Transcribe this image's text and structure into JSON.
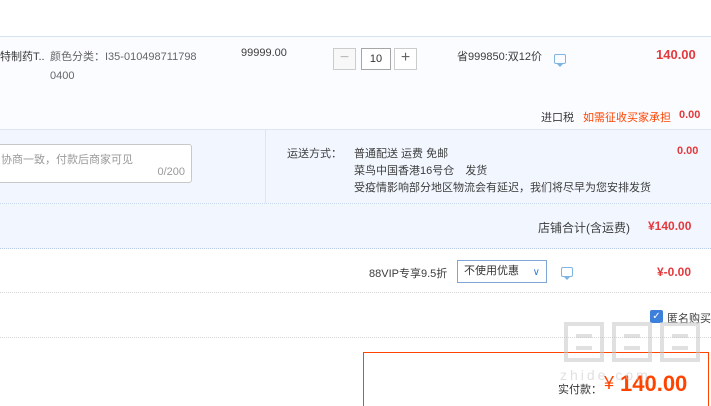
{
  "item": {
    "title_fragment": "特制药T...",
    "sku_line1": "颜色分类：I35-010498711798",
    "sku_line2": "0400",
    "unit_price": "99999.00",
    "quantity": "10",
    "decrease_symbol": "−",
    "increase_symbol": "+",
    "promo": "省999850:双12价",
    "subtotal": "140.00",
    "tax_label": "进口税",
    "tax_note": "如需征收买家承担",
    "tax_amount": "0.00"
  },
  "message": {
    "placeholder": "协商一致，付款后商家可见",
    "counter": "0/200"
  },
  "shipping": {
    "label": "运送方式：",
    "method": "普通配送 运费 免邮",
    "warehouse": "菜鸟中国香港16号仓",
    "ship_status": "发货",
    "notice": "受疫情影响部分地区物流会有延迟，我们将尽早为您安排发货",
    "fee": "0.00"
  },
  "shop_total": {
    "label": "店铺合计(含运费)",
    "amount": "¥140.00"
  },
  "vip": {
    "label": "88VIP专享9.5折",
    "select_value": "不使用优惠",
    "discount": "¥-0.00"
  },
  "anonymous": {
    "label": "匿名购买",
    "checked": true
  },
  "payment": {
    "label": "实付款：",
    "currency": "¥",
    "amount": "140.00"
  },
  "watermark": {
    "text": "值值值",
    "sub": "zhide.com"
  },
  "colors": {
    "accent": "#f40",
    "link_blue": "#3d80dc",
    "row_bg": "#f2f7ff"
  }
}
